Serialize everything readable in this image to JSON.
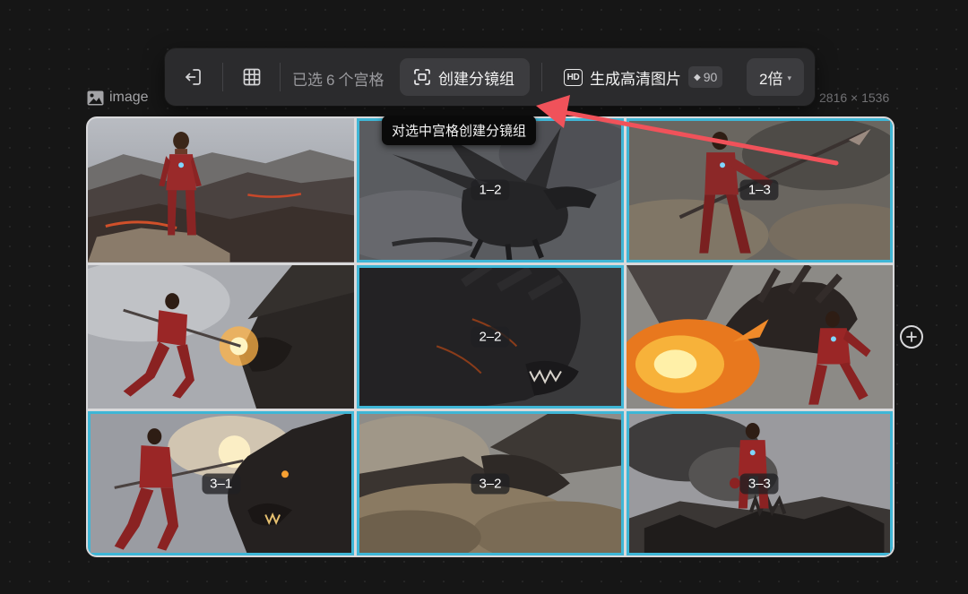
{
  "toolbar": {
    "exit_icon": "exit-icon",
    "grid_icon": "grid-icon",
    "status_prefix": "已选",
    "selected_count": "6",
    "status_suffix": "个宫格",
    "storyboard_icon": "scan-frame-icon",
    "storyboard_label": "创建分镜组",
    "hd_badge": "HD",
    "hd_label": "生成高清图片",
    "credit_value": "90",
    "multiplier_label": "2倍"
  },
  "tooltip": {
    "text": "对选中宫格创建分镜组"
  },
  "frame": {
    "icon": "image-icon",
    "label": "image",
    "dimensions": "2816 × 1536"
  },
  "grid": {
    "cells": [
      {
        "label": "",
        "selected": false,
        "scene": "hero-on-volcano"
      },
      {
        "label": "1–2",
        "selected": true,
        "scene": "dragon-in-smoke"
      },
      {
        "label": "1–3",
        "selected": true,
        "scene": "hero-with-spear"
      },
      {
        "label": "",
        "selected": false,
        "scene": "hero-attacks-dragon"
      },
      {
        "label": "2–2",
        "selected": true,
        "scene": "dragon-head-closeup"
      },
      {
        "label": "",
        "selected": false,
        "scene": "dragon-fire-breath"
      },
      {
        "label": "3–1",
        "selected": true,
        "scene": "hero-spear-dragon-head"
      },
      {
        "label": "3–2",
        "selected": true,
        "scene": "dragon-dust-cloud"
      },
      {
        "label": "3–3",
        "selected": true,
        "scene": "hero-on-fallen-dragon"
      }
    ]
  },
  "colors": {
    "selection": "#3fb6d6",
    "arrow": "#f0525a",
    "toolbar_bg": "#2b2b2d"
  }
}
